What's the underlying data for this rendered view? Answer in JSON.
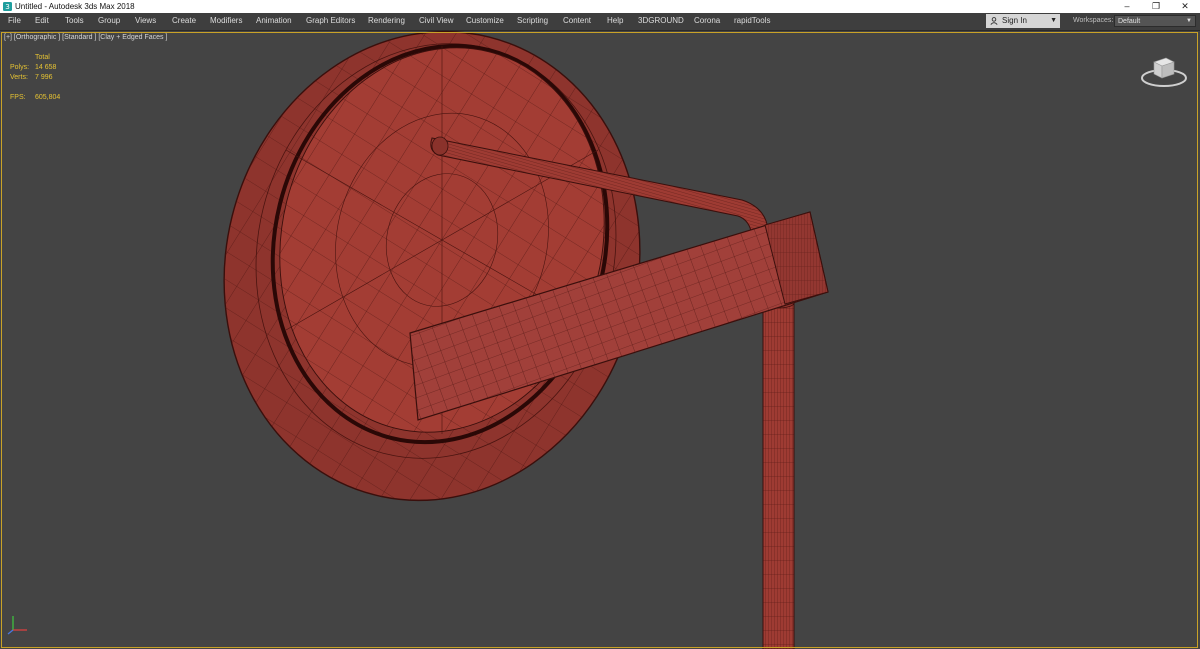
{
  "window": {
    "title": "Untitled - Autodesk 3ds Max 2018",
    "controls": [
      "–",
      "❐",
      "✕"
    ]
  },
  "menubar": {
    "items": [
      "File",
      "Edit",
      "Tools",
      "Group",
      "Views",
      "Create",
      "Modifiers",
      "Animation",
      "Graph Editors",
      "Rendering",
      "Civil View",
      "Customize",
      "Scripting",
      "Content",
      "Help",
      "3DGROUND",
      "Corona",
      "rapidTools"
    ],
    "sign_in": "Sign In",
    "workspaces_label": "Workspaces:",
    "workspace_value": "Default"
  },
  "viewport": {
    "label": "[+] [Orthographic ] [Standard ] [Clay + Edged Faces ]",
    "stats": {
      "header": "Total",
      "polys_label": "Polys:",
      "polys_value": "14 658",
      "verts_label": "Verts:",
      "verts_value": "7 996",
      "fps_label": "FPS:",
      "fps_value": "605,804"
    }
  },
  "colors": {
    "viewport_bg": "#444444",
    "model_red": "#9e3b33",
    "model_edge": "#3a0f0c",
    "stats_yellow": "#e6c333",
    "active_border": "#c9a227"
  },
  "icons": {
    "app": "3ds-max-app-icon",
    "signin": "user-icon",
    "viewcube": "viewcube-icon",
    "axis": "axis-tripod-icon"
  }
}
